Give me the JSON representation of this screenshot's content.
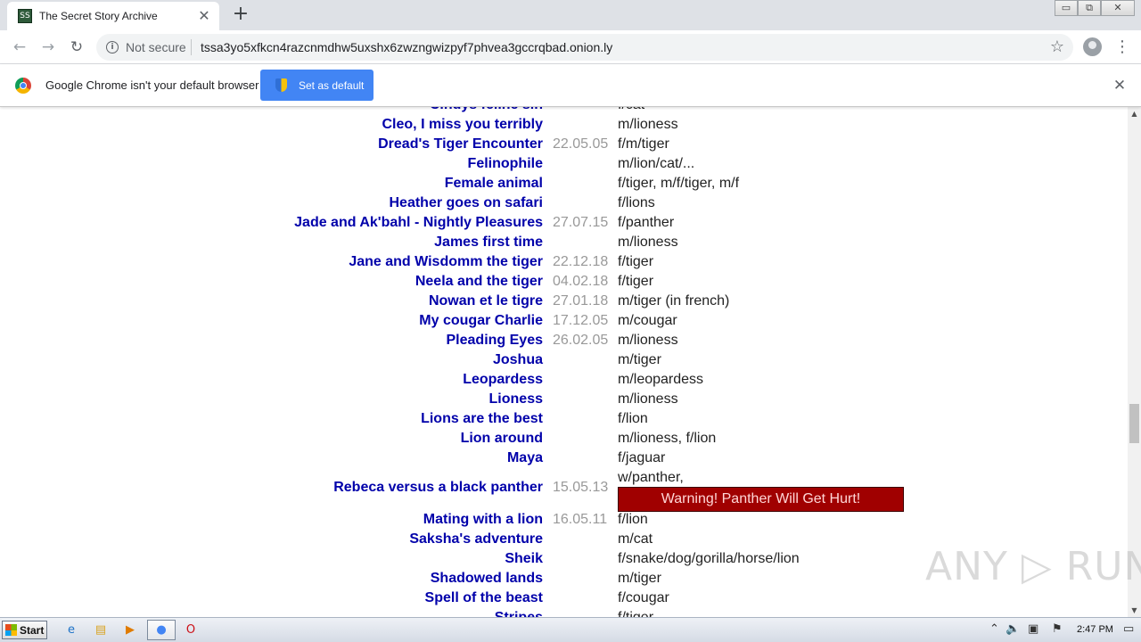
{
  "browser": {
    "tab_title": "The Secret Story Archive",
    "favicon_text": "SS",
    "close_glyph": "✕",
    "newtab_glyph": "+",
    "window": {
      "minimize": "▭",
      "restore": "⧉",
      "close": "✕"
    },
    "nav": {
      "back": "←",
      "forward": "→",
      "reload": "↻"
    },
    "not_secure": "Not secure",
    "url": "tssa3yo5xfkcn4razcnmdhw5uxshx6zwzngwizpyf7phvea3gccrqbad.onion.ly",
    "star_glyph": "☆",
    "menu_glyph": "⋮"
  },
  "infobar": {
    "message": "Google Chrome isn't your default browser",
    "button_label": "Set as default",
    "close_glyph": "✕"
  },
  "stories": [
    {
      "title": "Cindys feline sin",
      "date": "",
      "tags": "f/cat"
    },
    {
      "title": "Cleo, I miss you terribly",
      "date": "",
      "tags": "m/lioness"
    },
    {
      "title": "Dread's Tiger Encounter",
      "date": "22.05.05",
      "tags": "f/m/tiger"
    },
    {
      "title": "Felinophile",
      "date": "",
      "tags": "m/lion/cat/..."
    },
    {
      "title": "Female animal",
      "date": "",
      "tags": "f/tiger, m/f/tiger, m/f"
    },
    {
      "title": "Heather goes on safari",
      "date": "",
      "tags": "f/lions"
    },
    {
      "title": "Jade and Ak'bahl - Nightly Pleasures",
      "date": "27.07.15",
      "tags": "f/panther"
    },
    {
      "title": "James first time",
      "date": "",
      "tags": "m/lioness"
    },
    {
      "title": "Jane and Wisdomm the tiger",
      "date": "22.12.18",
      "tags": "f/tiger"
    },
    {
      "title": "Neela and the tiger",
      "date": "04.02.18",
      "tags": "f/tiger"
    },
    {
      "title": "Nowan et le tigre",
      "date": "27.01.18",
      "tags": "m/tiger (in french)"
    },
    {
      "title": "My cougar Charlie",
      "date": "17.12.05",
      "tags": "m/cougar"
    },
    {
      "title": "Pleading Eyes",
      "date": "26.02.05",
      "tags": "m/lioness"
    },
    {
      "title": "Joshua",
      "date": "",
      "tags": "m/tiger"
    },
    {
      "title": "Leopardess",
      "date": "",
      "tags": "m/leopardess"
    },
    {
      "title": "Lioness",
      "date": "",
      "tags": "m/lioness"
    },
    {
      "title": "Lions are the best",
      "date": "",
      "tags": "f/lion"
    },
    {
      "title": "Lion around",
      "date": "",
      "tags": "m/lioness, f/lion"
    },
    {
      "title": "Maya",
      "date": "",
      "tags": "f/jaguar"
    },
    {
      "title": "Rebeca versus a black panther",
      "date": "15.05.13",
      "tags": "w/panther,",
      "warning": "Warning! Panther Will Get Hurt!"
    },
    {
      "title": "Mating with a lion",
      "date": "16.05.11",
      "tags": "f/lion"
    },
    {
      "title": "Saksha's adventure",
      "date": "",
      "tags": "m/cat"
    },
    {
      "title": "Sheik",
      "date": "",
      "tags": "f/snake/dog/gorilla/horse/lion"
    },
    {
      "title": "Shadowed lands",
      "date": "",
      "tags": "m/tiger"
    },
    {
      "title": "Spell of the beast",
      "date": "",
      "tags": "f/cougar"
    },
    {
      "title": "Stripes",
      "date": "",
      "tags": "f/tiger"
    }
  ],
  "watermark": "ANY ▷ RUN",
  "scrollbar": {
    "up": "▲",
    "down": "▼"
  },
  "taskbar": {
    "start_label": "Start",
    "icons": [
      {
        "name": "ie-icon",
        "glyph": "e",
        "color": "#1e73c8"
      },
      {
        "name": "explorer-icon",
        "glyph": "▤",
        "color": "#d9a422"
      },
      {
        "name": "media-player-icon",
        "glyph": "▶",
        "color": "#e07b00"
      },
      {
        "name": "chrome-taskbar-icon",
        "glyph": "●",
        "color": "#4285f4"
      },
      {
        "name": "opera-icon",
        "glyph": "O",
        "color": "#cc0f16"
      }
    ],
    "tray": {
      "arrow": "⌃",
      "volume": "🔈",
      "network": "▣",
      "flag": "⚑",
      "monitor": "▭"
    },
    "clock": "2:47 PM"
  }
}
